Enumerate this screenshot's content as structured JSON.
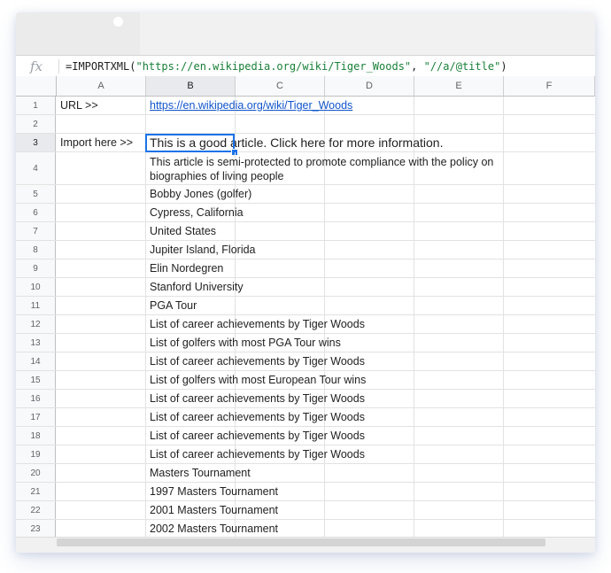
{
  "formula_bar": {
    "fx_label": "fx",
    "func": "=IMPORTXML(",
    "arg1": "\"https://en.wikipedia.org/wiki/Tiger_Woods\"",
    "sep": ", ",
    "arg2": "\"//a/@title\"",
    "close": ")"
  },
  "columns": [
    "A",
    "B",
    "C",
    "D",
    "E",
    "F"
  ],
  "rows": [
    {
      "num": "1",
      "a": "URL >>",
      "b": "https://en.wikipedia.org/wiki/Tiger_Woods"
    },
    {
      "num": "2",
      "a": "",
      "b": ""
    },
    {
      "num": "3",
      "a": "Import here >>",
      "b": "This is a good article. Click here for more information."
    },
    {
      "num": "4",
      "a": "",
      "b": "This article is semi-protected to promote compliance with the policy on biographies of living people"
    },
    {
      "num": "5",
      "a": "",
      "b": "Bobby Jones (golfer)"
    },
    {
      "num": "6",
      "a": "",
      "b": "Cypress, California"
    },
    {
      "num": "7",
      "a": "",
      "b": "United States"
    },
    {
      "num": "8",
      "a": "",
      "b": "Jupiter Island, Florida"
    },
    {
      "num": "9",
      "a": "",
      "b": "Elin Nordegren"
    },
    {
      "num": "10",
      "a": "",
      "b": "Stanford University"
    },
    {
      "num": "11",
      "a": "",
      "b": "PGA Tour"
    },
    {
      "num": "12",
      "a": "",
      "b": "List of career achievements by Tiger Woods"
    },
    {
      "num": "13",
      "a": "",
      "b": "List of golfers with most PGA Tour wins"
    },
    {
      "num": "14",
      "a": "",
      "b": "List of career achievements by Tiger Woods"
    },
    {
      "num": "15",
      "a": "",
      "b": "List of golfers with most European Tour wins"
    },
    {
      "num": "16",
      "a": "",
      "b": "List of career achievements by Tiger Woods"
    },
    {
      "num": "17",
      "a": "",
      "b": "List of career achievements by Tiger Woods"
    },
    {
      "num": "18",
      "a": "",
      "b": "List of career achievements by Tiger Woods"
    },
    {
      "num": "19",
      "a": "",
      "b": "List of career achievements by Tiger Woods"
    },
    {
      "num": "20",
      "a": "",
      "b": "Masters Tournament"
    },
    {
      "num": "21",
      "a": "",
      "b": "1997 Masters Tournament"
    },
    {
      "num": "22",
      "a": "",
      "b": "2001 Masters Tournament"
    },
    {
      "num": "23",
      "a": "",
      "b": "2002 Masters Tournament"
    }
  ],
  "colors": {
    "selection": "#1a73e8",
    "link": "#1155cc",
    "formula_string": "#188038"
  }
}
